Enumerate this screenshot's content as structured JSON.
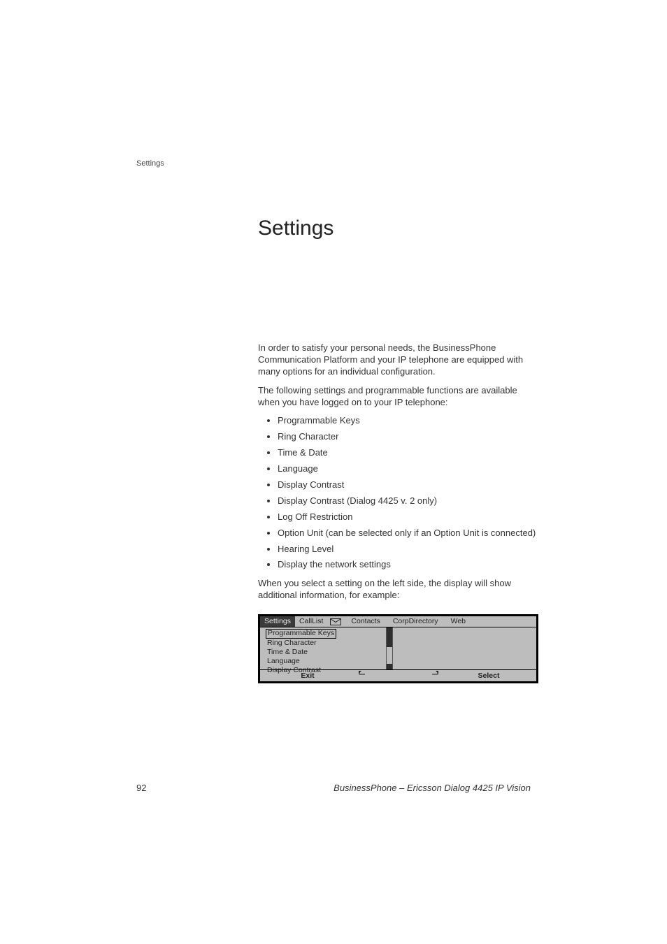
{
  "header": {
    "section_label": "Settings"
  },
  "title": "Settings",
  "paragraphs": {
    "p1": "In order to satisfy your personal needs, the BusinessPhone Communication Platform and your IP telephone are equipped with many options for an individual configuration.",
    "p2": "The following settings and programmable functions are available when you have logged on to your IP telephone:",
    "p3": "When you select a setting on the left side, the display will show additional information, for example:"
  },
  "bullets": [
    "Programmable Keys",
    "Ring Character",
    "Time & Date",
    "Language",
    "Display Contrast",
    "Display Contrast (Dialog 4425 v. 2 only)",
    "Log Off Restriction",
    "Option Unit (can be selected only if an Option Unit is connected)",
    "Hearing Level",
    "Display the network settings"
  ],
  "phone": {
    "tabs": {
      "settings": "Settings",
      "calllist": "CallList",
      "contacts": "Contacts",
      "corpdir": "CorpDirectory",
      "web": "Web"
    },
    "menu": {
      "item0": "Programmable Keys",
      "item1": "Ring Character",
      "item2": "Time & Date",
      "item3": "Language",
      "item4": "Display Contrast"
    },
    "footer": {
      "left": "Exit",
      "right": "Select"
    },
    "icons": {
      "envelope": "envelope-icon",
      "arrow_up_left": "arrow-up-left-icon",
      "arrow_up_right": "arrow-up-right-icon"
    }
  },
  "footer": {
    "page_number": "92",
    "product": "BusinessPhone – Ericsson Dialog 4425 IP Vision"
  }
}
